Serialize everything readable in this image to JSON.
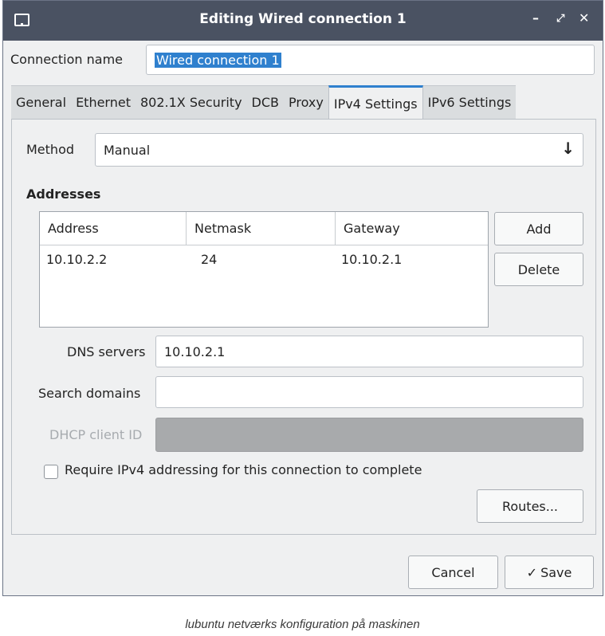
{
  "window": {
    "title": "Editing Wired connection 1",
    "minimize_icon": "minimize-icon",
    "maximize_icon": "maximize-icon",
    "close_icon": "close-icon"
  },
  "connection": {
    "label": "Connection name",
    "value": "Wired connection 1"
  },
  "tabs": [
    {
      "label": "General"
    },
    {
      "label": "Ethernet"
    },
    {
      "label": "802.1X Security"
    },
    {
      "label": "DCB"
    },
    {
      "label": "Proxy"
    },
    {
      "label": "IPv4 Settings",
      "active": true
    },
    {
      "label": "IPv6 Settings"
    }
  ],
  "ipv4": {
    "method_label": "Method",
    "method_value": "Manual",
    "addresses_heading": "Addresses",
    "columns": [
      "Address",
      "Netmask",
      "Gateway"
    ],
    "rows": [
      [
        "10.10.2.2",
        "24",
        "10.10.2.1"
      ]
    ],
    "add_label": "Add",
    "delete_label": "Delete",
    "dns_label": "DNS servers",
    "dns_value": "10.10.2.1",
    "search_label": "Search domains",
    "search_value": "",
    "dhcp_label": "DHCP client ID",
    "require_label": "Require IPv4 addressing for this connection to complete",
    "require_checked": false,
    "routes_label": "Routes..."
  },
  "footer": {
    "cancel_label": "Cancel",
    "save_label": "Save",
    "save_icon": "checkmark-icon"
  },
  "caption": "lubuntu netværks konfiguration på maskinen",
  "colors": {
    "titlebar": "#4a5262",
    "accent": "#2f80ce",
    "window_bg": "#eff0f1"
  }
}
